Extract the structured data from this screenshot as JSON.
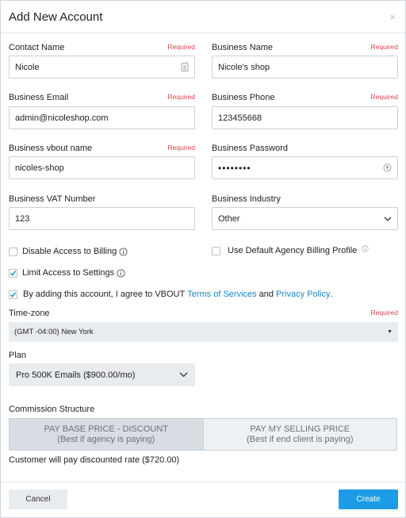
{
  "dialog": {
    "title": "Add New Account",
    "close": "×"
  },
  "required_text": "Required",
  "fields": {
    "contact_name": {
      "label": "Contact Name",
      "value": "Nicole"
    },
    "business_name": {
      "label": "Business Name",
      "value": "Nicole's shop"
    },
    "business_email": {
      "label": "Business Email",
      "value": "admin@nicoleshop.com"
    },
    "business_phone": {
      "label": "Business Phone",
      "value": "123455668"
    },
    "vbout_name": {
      "label": "Business vbout name",
      "value": "nicoles-shop"
    },
    "business_password": {
      "label": "Business Password",
      "value": "••••••••"
    },
    "vat_number": {
      "label": "Business VAT Number",
      "value": "123"
    },
    "industry": {
      "label": "Business Industry",
      "value": "Other"
    }
  },
  "checkboxes": {
    "disable_billing": {
      "label": "Disable Access to Billing",
      "checked": false
    },
    "default_billing_profile": {
      "label": "Use Default Agency Billing Profile",
      "checked": false
    },
    "limit_settings": {
      "label": "Limit Access to Settings",
      "checked": true
    },
    "agree": {
      "checked": true,
      "text_before": "By adding this account, I agree to VBOUT",
      "terms_link": "Terms of Services",
      "and_text": "and",
      "privacy_link": "Privacy Policy",
      "end": "."
    }
  },
  "timezone": {
    "label": "Time-zone",
    "value": "(GMT -04:00) New York"
  },
  "plan": {
    "label": "Plan",
    "value": "Pro 500K Emails ($900.00/mo)"
  },
  "commission": {
    "label": "Commission Structure",
    "options": [
      {
        "title": "PAY BASE PRICE - DISCOUNT",
        "subtitle": "(Best if agency is paying)",
        "active": true
      },
      {
        "title": "PAY MY SELLING PRICE",
        "subtitle": "(Best if end client is paying)",
        "active": false
      }
    ],
    "note": "Customer will pay discounted rate ($720.00)"
  },
  "footer": {
    "cancel": "Cancel",
    "create": "Create"
  },
  "colors": {
    "accent": "#1e9be6",
    "required": "#e0404a",
    "link": "#1a86c8"
  }
}
